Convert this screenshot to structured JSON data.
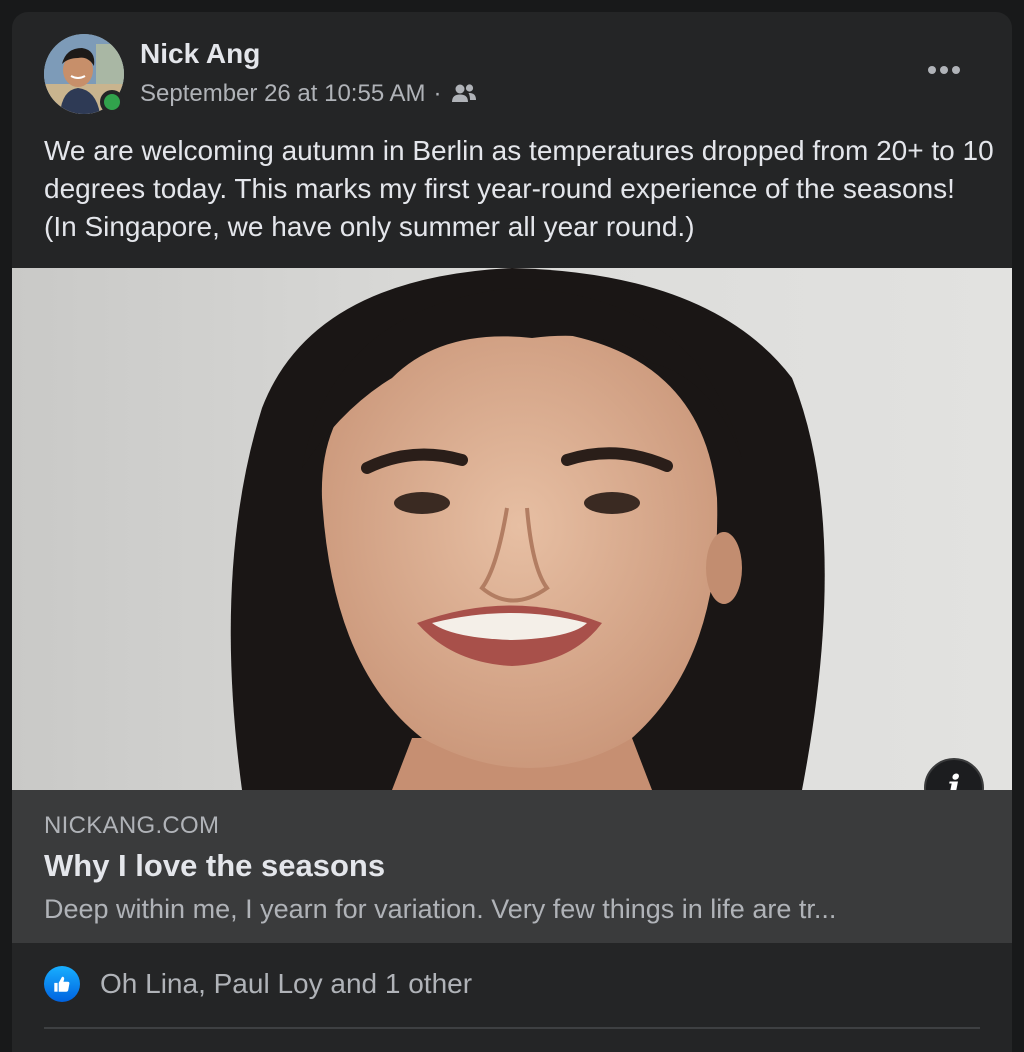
{
  "post": {
    "author": "Nick Ang",
    "timestamp": "September 26 at 10:55 AM",
    "separator": "·",
    "audience_icon": "friends-icon",
    "more_icon": "more-horizontal-icon",
    "body": "We are welcoming autumn in Berlin as temperatures dropped from 20+ to 10 degrees today. This marks my first year-round experience of the seasons! (In Singapore, we have only summer all year round.)",
    "author_online": true
  },
  "link_preview": {
    "domain": "NICKANG.COM",
    "title": "Why I love the seasons",
    "description": "Deep within me, I yearn for variation. Very few things in life are tr...",
    "info_label": "i"
  },
  "reactions": {
    "icon": "like-icon",
    "names": "Oh Lina, Paul Loy and 1 other"
  },
  "colors": {
    "card_bg": "#242526",
    "page_bg": "#18191a",
    "primary_text": "#e4e6eb",
    "secondary_text": "#b0b3b8",
    "online": "#31a24c",
    "like_blue": "#0062df"
  }
}
